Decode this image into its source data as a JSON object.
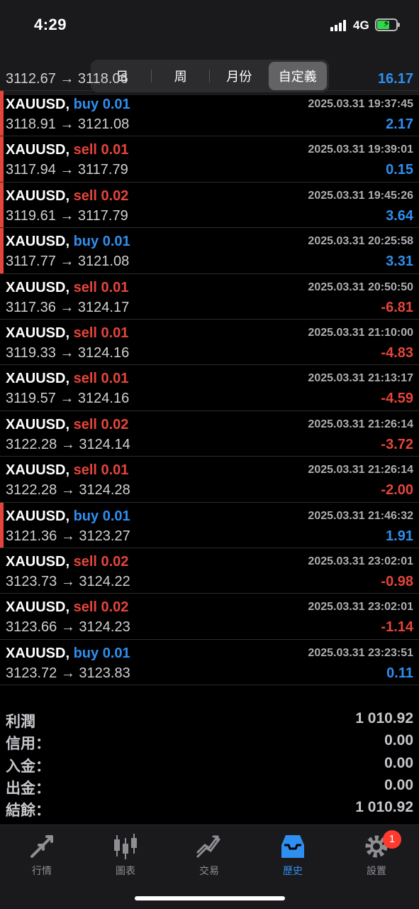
{
  "status": {
    "time": "4:29",
    "network": "4G"
  },
  "segments": [
    "日",
    "周",
    "月份",
    "自定義"
  ],
  "partial_row": {
    "prices": "3112.67 → 3118.06",
    "profit": "16.17"
  },
  "trades": [
    {
      "symbol": "XAUUSD,",
      "side": "buy",
      "volume": "0.01",
      "time": "2025.03.31 19:37:45",
      "prices": "3118.91 → 3121.08",
      "profit": "2.17",
      "marked": true
    },
    {
      "symbol": "XAUUSD,",
      "side": "sell",
      "volume": "0.01",
      "time": "2025.03.31 19:39:01",
      "prices": "3117.94 → 3117.79",
      "profit": "0.15",
      "marked": true
    },
    {
      "symbol": "XAUUSD,",
      "side": "sell",
      "volume": "0.02",
      "time": "2025.03.31 19:45:26",
      "prices": "3119.61 → 3117.79",
      "profit": "3.64",
      "marked": true
    },
    {
      "symbol": "XAUUSD,",
      "side": "buy",
      "volume": "0.01",
      "time": "2025.03.31 20:25:58",
      "prices": "3117.77 → 3121.08",
      "profit": "3.31",
      "marked": true
    },
    {
      "symbol": "XAUUSD,",
      "side": "sell",
      "volume": "0.01",
      "time": "2025.03.31 20:50:50",
      "prices": "3117.36 → 3124.17",
      "profit": "-6.81",
      "marked": false
    },
    {
      "symbol": "XAUUSD,",
      "side": "sell",
      "volume": "0.01",
      "time": "2025.03.31 21:10:00",
      "prices": "3119.33 → 3124.16",
      "profit": "-4.83",
      "marked": false
    },
    {
      "symbol": "XAUUSD,",
      "side": "sell",
      "volume": "0.01",
      "time": "2025.03.31 21:13:17",
      "prices": "3119.57 → 3124.16",
      "profit": "-4.59",
      "marked": false
    },
    {
      "symbol": "XAUUSD,",
      "side": "sell",
      "volume": "0.02",
      "time": "2025.03.31 21:26:14",
      "prices": "3122.28 → 3124.14",
      "profit": "-3.72",
      "marked": false
    },
    {
      "symbol": "XAUUSD,",
      "side": "sell",
      "volume": "0.01",
      "time": "2025.03.31 21:26:14",
      "prices": "3122.28 → 3124.28",
      "profit": "-2.00",
      "marked": false
    },
    {
      "symbol": "XAUUSD,",
      "side": "buy",
      "volume": "0.01",
      "time": "2025.03.31 21:46:32",
      "prices": "3121.36 → 3123.27",
      "profit": "1.91",
      "marked": true
    },
    {
      "symbol": "XAUUSD,",
      "side": "sell",
      "volume": "0.02",
      "time": "2025.03.31 23:02:01",
      "prices": "3123.73 → 3124.22",
      "profit": "-0.98",
      "marked": false
    },
    {
      "symbol": "XAUUSD,",
      "side": "sell",
      "volume": "0.02",
      "time": "2025.03.31 23:02:01",
      "prices": "3123.66 → 3124.23",
      "profit": "-1.14",
      "marked": false
    },
    {
      "symbol": "XAUUSD,",
      "side": "buy",
      "volume": "0.01",
      "time": "2025.03.31 23:23:51",
      "prices": "3123.72 → 3123.83",
      "profit": "0.11",
      "marked": false
    }
  ],
  "summary": [
    {
      "label": "利潤",
      "value": "1 010.92"
    },
    {
      "label": "信用：",
      "value": "0.00"
    },
    {
      "label": "入金：",
      "value": "0.00"
    },
    {
      "label": "出金：",
      "value": "0.00"
    },
    {
      "label": "結餘：",
      "value": "1 010.92"
    }
  ],
  "tabs": [
    {
      "label": "行情",
      "icon": "quotes-arrows-icon"
    },
    {
      "label": "圖表",
      "icon": "candlestick-chart-icon"
    },
    {
      "label": "交易",
      "icon": "trade-line-icon"
    },
    {
      "label": "歷史",
      "icon": "history-tray-icon",
      "active": true
    },
    {
      "label": "設置",
      "icon": "gear-icon",
      "badge": "1"
    }
  ],
  "colors": {
    "buy": "#2f8ff0",
    "sell": "#e5453b",
    "accent": "#2f8ff0",
    "badge": "#ff3b30"
  }
}
